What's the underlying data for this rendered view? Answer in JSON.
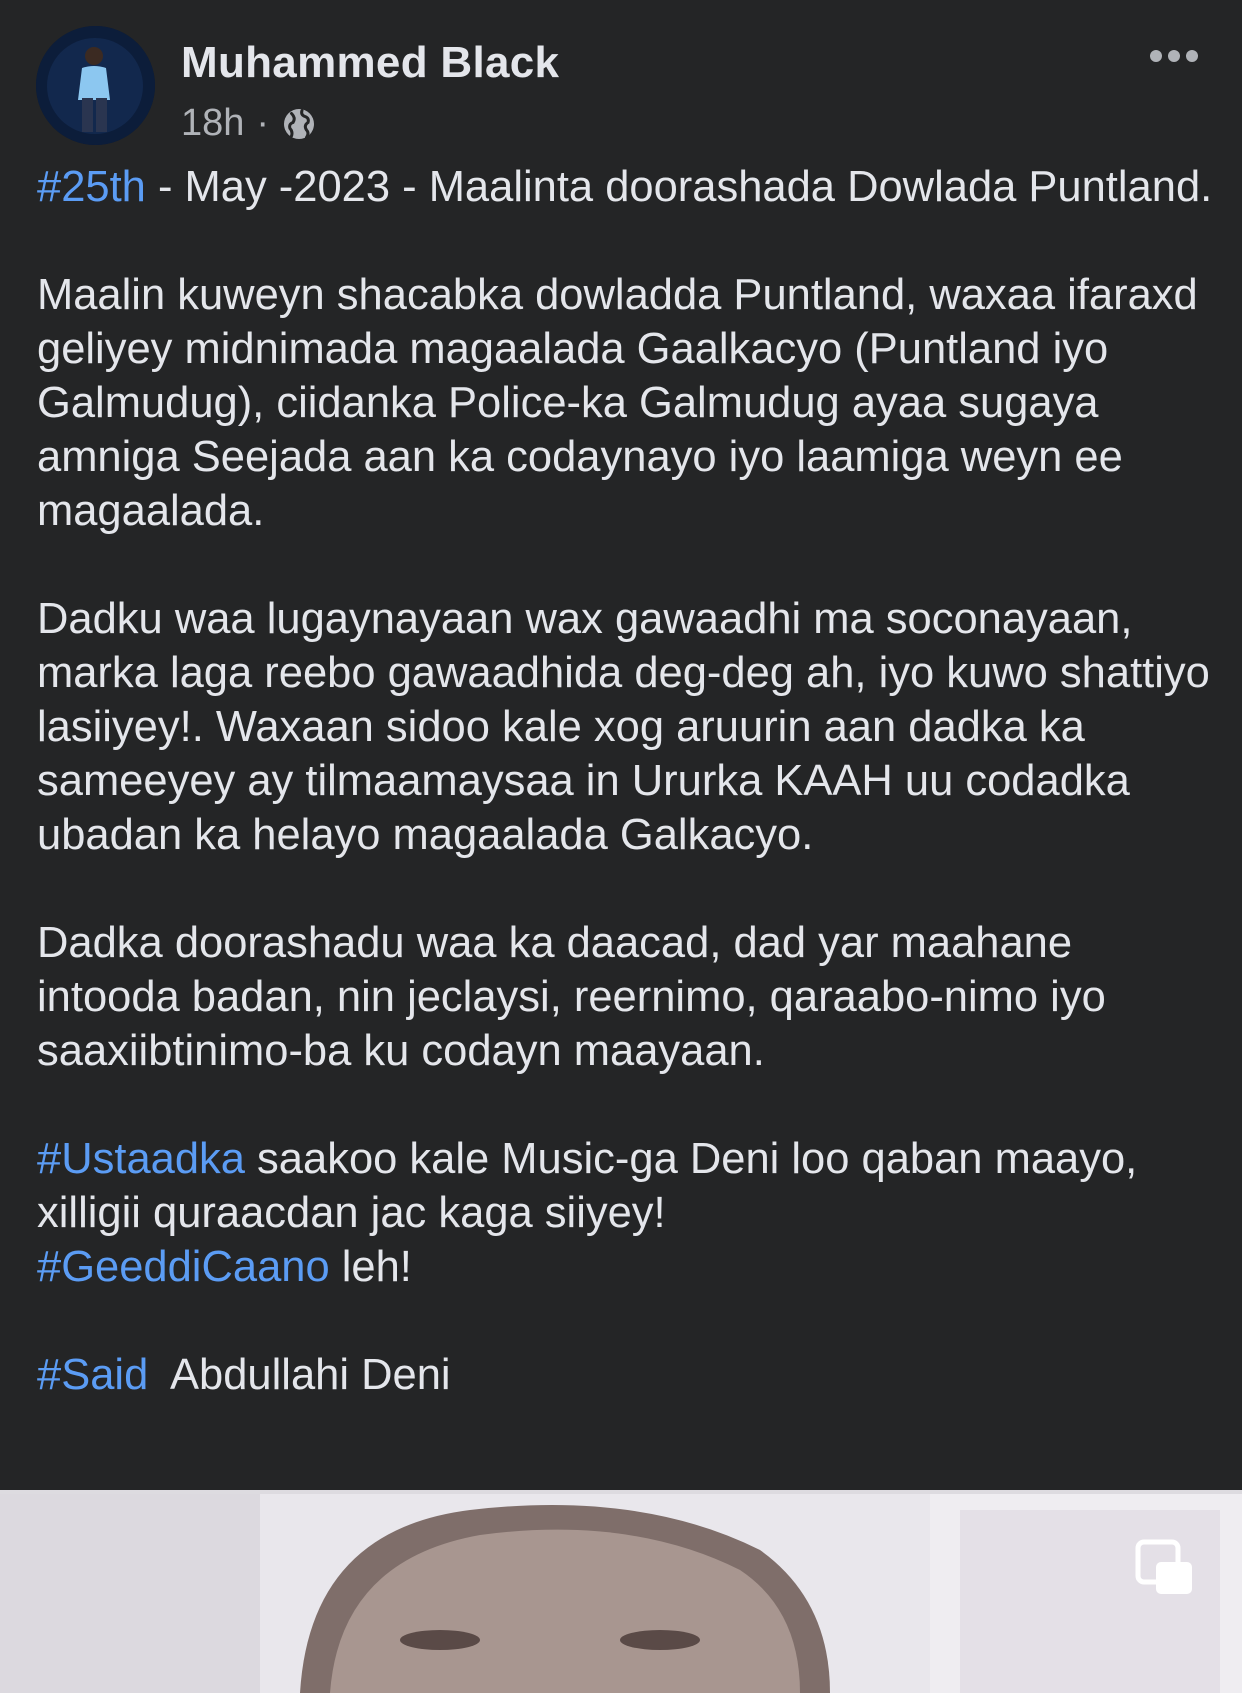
{
  "post": {
    "author": "Muhammed Black",
    "time": "18h",
    "separator": "·",
    "privacy_icon": "globe-icon",
    "menu_icon": "more-horizontal-icon"
  },
  "body": {
    "p1": {
      "tag": "#25th",
      "text": " - May -2023 - Maalinta doorashada Dowlada Puntland."
    },
    "p2": "Maalin kuweyn shacabka dowladda Puntland, waxaa ifaraxd geliyey midnimada magaalada Gaalkacyo (Puntland iyo Galmudug), ciidanka Police-ka Galmudug ayaa sugaya amniga Seejada aan ka codaynayo iyo laamiga weyn ee magaalada.",
    "p3": "Dadku waa lugaynayaan wax gawaadhi ma soconayaan, marka laga reebo gawaadhida deg-deg ah, iyo kuwo shattiyo lasiiyey!. Waxaan sidoo kale xog aruurin aan dadka ka sameeyey ay tilmaamaysaa in Ururka KAAH uu codadka ubadan ka helayo magaalada Galkacyo.",
    "p4": "Dadka doorashadu waa ka daacad, dad yar maahane intooda badan, nin jeclaysi, reernimo, qaraabo-nimo iyo saaxiibtinimo-ba ku codayn maayaan.",
    "p5": {
      "tag1": "#Ustaadka",
      "text1": " saakoo kale Music-ga Deni loo qaban maayo, xilligii quraacdan jac kaga siiyey!",
      "tag2": "#GeeddiCaano",
      "text2": " leh!"
    },
    "p6": {
      "tag": "#Said",
      "text": "  Abdullahi Deni"
    }
  },
  "media": {
    "icon": "multiple-photos-icon"
  },
  "colors": {
    "background": "#242526",
    "text": "#e4e6eb",
    "secondary": "#b0b3b8",
    "hashtag": "#5b9cf4"
  }
}
